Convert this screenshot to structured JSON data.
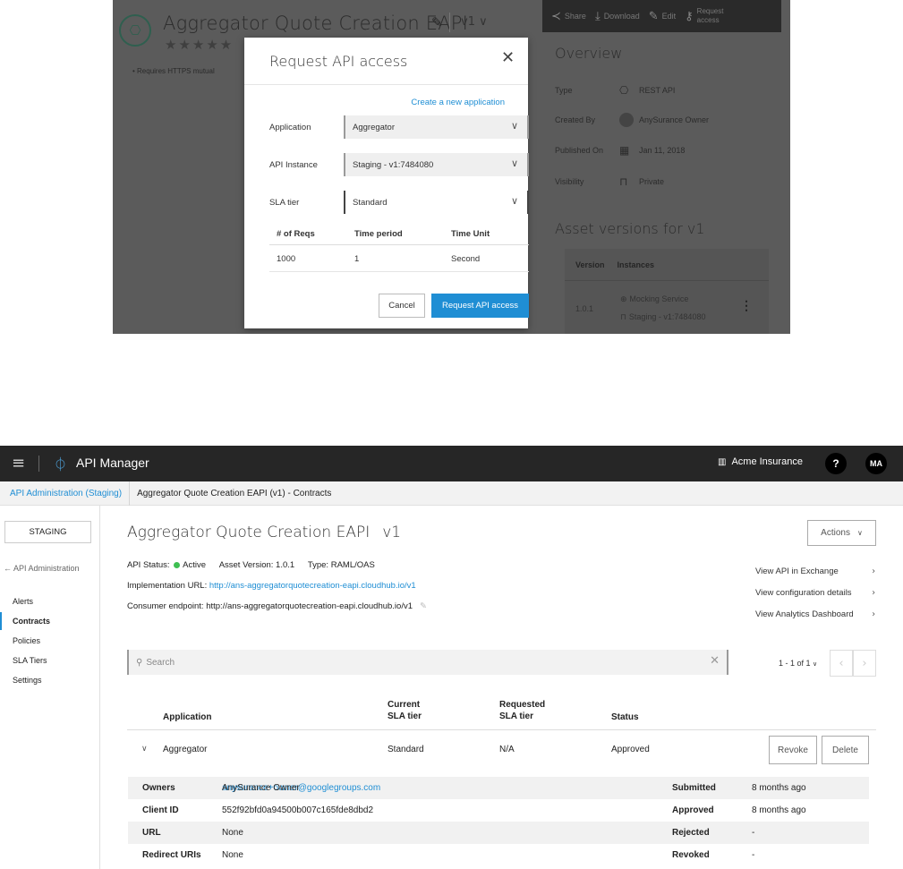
{
  "exchange": {
    "api_title": "Aggregator Quote Creation EAPI",
    "version_selector": "v1 ∨",
    "rating_stars": "★★★★★",
    "requirement_bullet": "•  Requires HTTPS mutual",
    "toolbar": {
      "share": "Share",
      "download": "Download",
      "edit": "Edit",
      "request_access": "Request access"
    },
    "overview": {
      "heading": "Overview",
      "type_label": "Type",
      "type_value": "REST API",
      "created_by_label": "Created By",
      "created_by_value": "AnySurance Owner",
      "published_label": "Published On",
      "published_value": "Jan 11, 2018",
      "visibility_label": "Visibility",
      "visibility_value": "Private"
    },
    "versions": {
      "heading": "Asset versions for v1",
      "col_version": "Version",
      "col_instances": "Instances",
      "version": "1.0.1",
      "instance_1": "Mocking Service",
      "instance_2": "Staging - v1:7484080"
    }
  },
  "modal": {
    "title": "Request API access",
    "create_link": "Create a new application",
    "application_label": "Application",
    "application_value": "Aggregator",
    "instance_label": "API Instance",
    "instance_value": "Staging - v1:7484080",
    "sla_label": "SLA tier",
    "sla_value": "Standard",
    "table": {
      "headers": [
        "# of Reqs",
        "Time period",
        "Time Unit"
      ],
      "row": [
        "1000",
        "1",
        "Second"
      ]
    },
    "cancel": "Cancel",
    "submit": "Request API access"
  },
  "topbar": {
    "app_name": "API Manager",
    "org": "Acme Insurance",
    "help": "?",
    "avatar": "MA"
  },
  "breadcrumb": {
    "parent": "API Administration (Staging)",
    "current": "Aggregator Quote Creation EAPI (v1) - Contracts"
  },
  "sidebar": {
    "environment": "STAGING",
    "back": "← API Administration",
    "items": [
      "Alerts",
      "Contracts",
      "Policies",
      "SLA Tiers",
      "Settings"
    ],
    "active": "Contracts"
  },
  "api": {
    "name": "Aggregator Quote Creation EAPI",
    "version": "v1",
    "actions": "Actions",
    "status_label": "API Status:",
    "status_value": "Active",
    "asset_version": "Asset Version: 1.0.1",
    "type": "Type: RAML/OAS",
    "impl_label": "Implementation URL:",
    "impl_url": "http://ans-aggregatorquotecreation-eapi.cloudhub.io/v1",
    "consumer_label": "Consumer endpoint:",
    "consumer_url": "http://ans-aggregatorquotecreation-eapi.cloudhub.io/v1",
    "links": [
      "View API in Exchange",
      "View configuration details",
      "View Analytics Dashboard"
    ]
  },
  "search": {
    "placeholder": "Search"
  },
  "pagination": {
    "label": "1 - 1 of 1"
  },
  "contracts": {
    "headers": {
      "application": "Application",
      "current_sla_1": "Current",
      "current_sla_2": "SLA tier",
      "requested_sla_1": "Requested",
      "requested_sla_2": "SLA tier",
      "status": "Status"
    },
    "rows": [
      {
        "application": "Aggregator",
        "current_sla": "Standard",
        "requested_sla": "N/A",
        "status": "Approved"
      }
    ],
    "revoke": "Revoke",
    "delete": "Delete",
    "details": {
      "owners_label": "Owners",
      "owners_name": "AnySurance Owner",
      "owners_email": "anysurance+owner@googlegroups.com",
      "client_id_label": "Client ID",
      "client_id": "552f92bfd0a94500b007c165fde8dbd2",
      "url_label": "URL",
      "url": "None",
      "redirect_label": "Redirect URIs",
      "redirect": "None",
      "submitted_label": "Submitted",
      "submitted": "8 months ago",
      "approved_label": "Approved",
      "approved": "8 months ago",
      "rejected_label": "Rejected",
      "rejected": "-",
      "revoked_label": "Revoked",
      "revoked": "-"
    }
  },
  "colors": {
    "accent": "#1f8ed4",
    "active_dot": "#3fbf52",
    "topbar": "#262626",
    "overlay": "#5b5b5b"
  }
}
